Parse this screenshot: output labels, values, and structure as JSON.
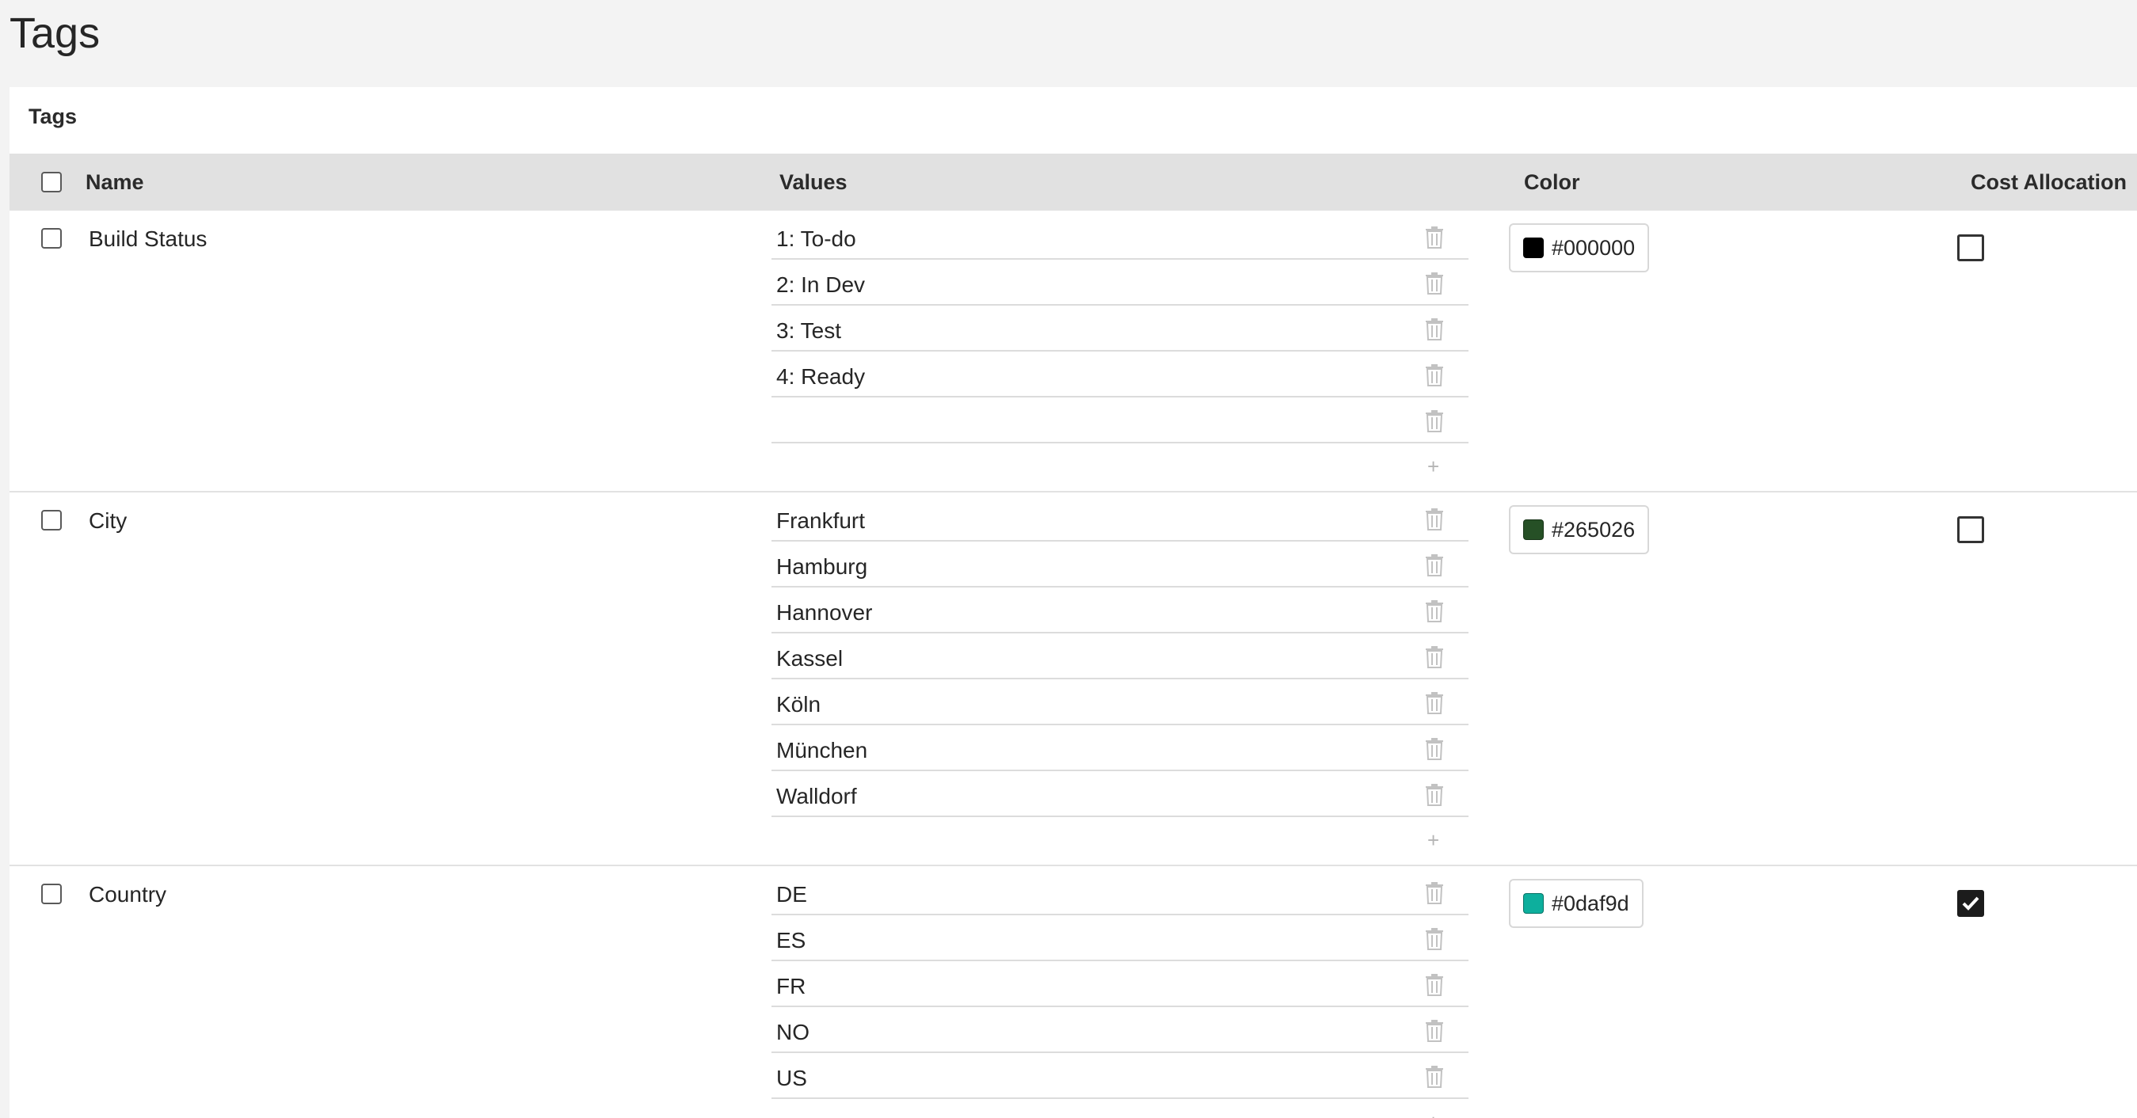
{
  "page": {
    "title": "Tags"
  },
  "card": {
    "title": "Tags"
  },
  "table": {
    "columns": {
      "name": "Name",
      "values": "Values",
      "color": "Color",
      "cost_allocation": "Cost Allocation"
    },
    "add_value_symbol": "+",
    "rows": [
      {
        "name": "Build Status",
        "values": [
          "1: To-do",
          "2: In Dev",
          "3: Test",
          "4: Ready",
          ""
        ],
        "color": "#000000",
        "cost_allocation": false
      },
      {
        "name": "City",
        "values": [
          "Frankfurt",
          "Hamburg",
          "Hannover",
          "Kassel",
          "Köln",
          "München",
          "Walldorf"
        ],
        "color": "#265026",
        "cost_allocation": false
      },
      {
        "name": "Country",
        "values": [
          "DE",
          "ES",
          "FR",
          "NO",
          "US"
        ],
        "color": "#0daf9d",
        "cost_allocation": true
      }
    ]
  },
  "icons": {
    "delete": "trash-icon",
    "add": "plus-icon",
    "check": "checkmark-icon"
  }
}
